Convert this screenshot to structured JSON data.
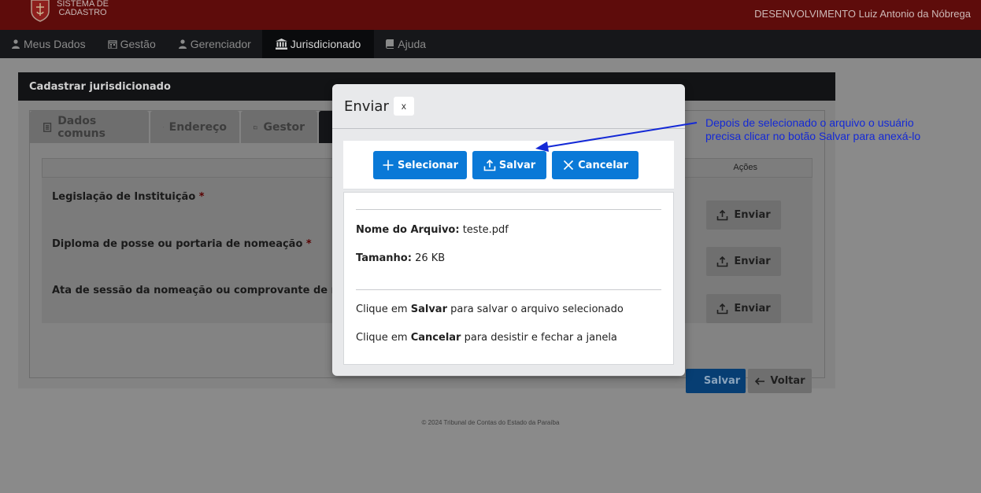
{
  "header": {
    "logo_line1": "SISTEMA DE",
    "logo_line2": "CADASTRO",
    "user": "DESENVOLVIMENTO Luiz Antonio da Nóbrega"
  },
  "nav": {
    "items": [
      {
        "label": "Meus Dados",
        "icon": "user-icon"
      },
      {
        "label": "Gestão",
        "icon": "calendar-icon"
      },
      {
        "label": "Gerenciador",
        "icon": "user-icon"
      },
      {
        "label": "Jurisdicionado",
        "icon": "institution-icon",
        "active": true
      },
      {
        "label": "Ajuda",
        "icon": "book-icon"
      }
    ]
  },
  "card": {
    "title": "Cadastrar jurisdicionado",
    "tabs": [
      {
        "label": "Dados comuns",
        "icon": "document-icon"
      },
      {
        "label": "Endereço",
        "icon": "building-icon"
      },
      {
        "label": "Gestor",
        "icon": "folder-icon"
      }
    ],
    "table": {
      "actions_header": "Ações",
      "rows": [
        {
          "label": "Legislação de Instituição",
          "required": "*",
          "action": "Enviar"
        },
        {
          "label": "Diploma de posse ou portaria de nomeação",
          "required": "*",
          "action": "Enviar"
        },
        {
          "label": "Ata de sessão da nomeação ou comprovante de nomea",
          "required": "",
          "action": "Enviar"
        }
      ]
    },
    "save_label": "Salvar",
    "back_label": "Voltar"
  },
  "footer": "© 2024 Tribunal de Contas do Estado da Paraíba",
  "modal": {
    "title": "Enviar",
    "close_label": "x",
    "buttons": {
      "select": "Selecionar",
      "save": "Salvar",
      "cancel": "Cancelar"
    },
    "file_name_label": "Nome do Arquivo:",
    "file_name": "teste.pdf",
    "size_label": "Tamanho:",
    "size": "26 KB",
    "hint1_pre": "Clique em",
    "hint1_bold": "Salvar",
    "hint1_post": "para salvar o arquivo selecionado",
    "hint2_pre": "Clique em",
    "hint2_bold": "Cancelar",
    "hint2_post": "para desistir e fechar a janela"
  },
  "annotation": {
    "line1": "Depois de selecionado o arquivo o usuário",
    "line2": "precisa clicar no botão Salvar para anexá-lo",
    "color": "#1429d6"
  },
  "colors": {
    "primary": "#0a79d7",
    "header": "#5e0c0b",
    "nav": "#16171a"
  }
}
